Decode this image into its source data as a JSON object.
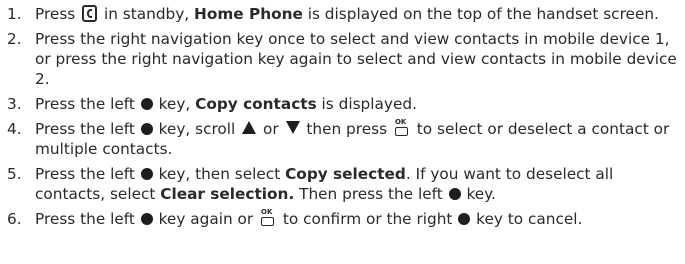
{
  "steps": [
    {
      "num": "1.",
      "t1": "Press ",
      "t2": " in standby, ",
      "b1": "Home Phone",
      "t3": " is displayed on the top of the handset screen."
    },
    {
      "num": "2.",
      "t1": "Press the right navigation key once to select and view contacts in mobile device 1, or press the right navigation key again to select and view contacts in mobile device 2."
    },
    {
      "num": "3.",
      "t1": "Press the left ",
      "t2": " key, ",
      "b1": "Copy contacts",
      "t3": " is displayed."
    },
    {
      "num": "4.",
      "t1": "Press the left ",
      "t2": " key, scroll ",
      "t3": " or ",
      "t4": " then press ",
      "t5": " to select or deselect a contact or multiple contacts."
    },
    {
      "num": "5.",
      "t1": "Press the left ",
      "t2": " key, then select ",
      "b1": "Copy selected",
      "t3": ". If you want to deselect all contacts, select ",
      "b2": "Clear selection.",
      "t4": " Then press the left ",
      "t5": " key."
    },
    {
      "num": "6.",
      "t1": "Press the left ",
      "t2": " key again or ",
      "t3": " to confirm or the right ",
      "t4": " key to cancel."
    }
  ],
  "icons": {
    "ok_label": "OK",
    "phone_key": "phone-key-icon",
    "soft_key": "soft-key-dot-icon",
    "up_key": "up-triangle-icon",
    "down_key": "down-triangle-icon",
    "ok_key": "ok-key-icon"
  }
}
